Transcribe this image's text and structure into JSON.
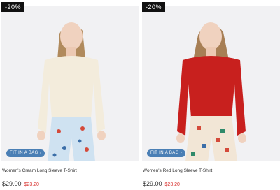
{
  "products": [
    {
      "badge": "-20%",
      "fit_label": "FIT IN A BAG",
      "name": "Women's Cream Long Sleeve T-Shirt",
      "old_price": "$29.00",
      "new_price": "$23.20",
      "shirt_color": "#f3ecdc",
      "pants_color": "#cfe2f1"
    },
    {
      "badge": "-20%",
      "fit_label": "FIT IN A BAG",
      "name": "Women's Red Long Sleeve T-Shirt",
      "old_price": "$29.00",
      "new_price": "$23.20",
      "shirt_color": "#c8201e",
      "pants_color": "#f2e6d6"
    }
  ]
}
